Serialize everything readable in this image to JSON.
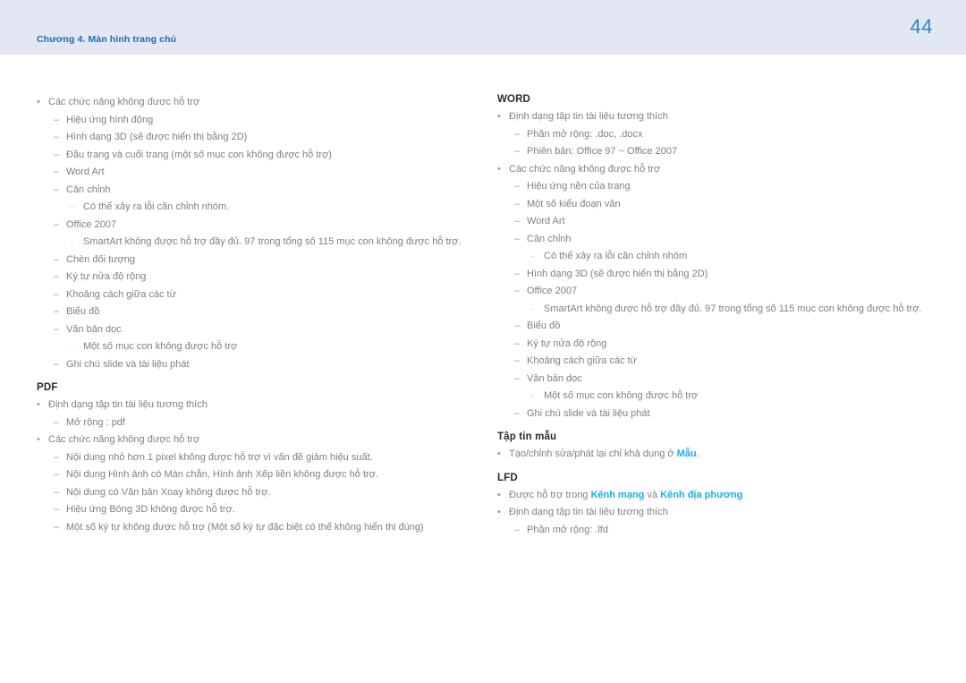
{
  "header": {
    "chapter": "Chương 4. Màn hình trang chủ",
    "page_number": "44",
    "band_color": "#e3e7f4",
    "chapter_color": "#1a6cb2",
    "page_number_color": "#2589c9"
  },
  "theme": {
    "body_text_color": "#808080",
    "heading_color": "#2b2b2b",
    "link_color": "#15b0ea",
    "marker_color": "#9a9a9a"
  },
  "markers": {
    "level1": "•",
    "level2": "–",
    "level3": "·"
  },
  "left_column": {
    "blocks": [
      {
        "heading": null,
        "items": [
          {
            "level": 1,
            "text": "Các chức năng không được hỗ trợ"
          },
          {
            "level": 2,
            "text": "Hiệu ứng hình động"
          },
          {
            "level": 2,
            "text": "Hình dạng 3D (sẽ được hiển thị bằng 2D)"
          },
          {
            "level": 2,
            "text": "Đầu trang và cuối trang (một số mục con không được hỗ trợ)"
          },
          {
            "level": 2,
            "text": "Word Art"
          },
          {
            "level": 2,
            "text": "Căn chỉnh"
          },
          {
            "level": 3,
            "text": "Có thể xảy ra lỗi căn chỉnh nhóm."
          },
          {
            "level": 2,
            "text": "Office 2007"
          },
          {
            "level": 3,
            "text": "SmartArt không được hỗ trợ đầy đủ. 97 trong tổng số 115 mục con không được hỗ trợ."
          },
          {
            "level": 2,
            "text": "Chèn đối tượng"
          },
          {
            "level": 2,
            "text": "Ký tự nửa độ rộng"
          },
          {
            "level": 2,
            "text": "Khoảng cách giữa các từ"
          },
          {
            "level": 2,
            "text": "Biểu đồ"
          },
          {
            "level": 2,
            "text": "Văn bản dọc"
          },
          {
            "level": 3,
            "text": "Một số mục con không được hỗ trợ"
          },
          {
            "level": 2,
            "text": "Ghi chú slide và tài liệu phát"
          }
        ]
      },
      {
        "heading": "PDF",
        "items": [
          {
            "level": 1,
            "text": "Định dạng tập tin tài liệu tương thích"
          },
          {
            "level": 2,
            "text": "Mở rộng : pdf"
          },
          {
            "level": 1,
            "text": "Các chức năng không được hỗ trợ"
          },
          {
            "level": 2,
            "text": "Nội dung nhỏ hơn 1 pixel không được hỗ trợ vì vấn đề giảm hiệu suất."
          },
          {
            "level": 2,
            "text": "Nội dung Hình ảnh có Màn chắn, Hình ảnh Xếp liền không được hỗ trợ."
          },
          {
            "level": 2,
            "text": "Nội dung có Văn bản Xoay không được hỗ trợ."
          },
          {
            "level": 2,
            "text": "Hiệu ứng Bóng 3D không được hỗ trợ."
          },
          {
            "level": 2,
            "text": "Một số ký tự không được hỗ trợ (Một số ký tự đặc biệt có thể không hiển thị đúng)"
          }
        ]
      }
    ]
  },
  "right_column": {
    "blocks": [
      {
        "heading": "WORD",
        "items": [
          {
            "level": 1,
            "text": "Định dạng tập tin tài liệu tương thích"
          },
          {
            "level": 2,
            "text": "Phần mở rộng: .doc, .docx"
          },
          {
            "level": 2,
            "text": "Phiên bản: Office 97 ~ Office 2007"
          },
          {
            "level": 1,
            "text": "Các chức năng không được hỗ trợ"
          },
          {
            "level": 2,
            "text": "Hiệu ứng nền của trang"
          },
          {
            "level": 2,
            "text": "Một số kiểu đoạn văn"
          },
          {
            "level": 2,
            "text": "Word Art"
          },
          {
            "level": 2,
            "text": "Căn chỉnh"
          },
          {
            "level": 3,
            "text": "Có thể xảy ra lỗi căn chỉnh nhóm"
          },
          {
            "level": 2,
            "text": "Hình dạng 3D (sẽ được hiển thị bằng 2D)"
          },
          {
            "level": 2,
            "text": "Office 2007"
          },
          {
            "level": 3,
            "text": "SmartArt không được hỗ trợ đầy đủ. 97 trong tổng số 115 mục con không được hỗ trợ."
          },
          {
            "level": 2,
            "text": "Biểu đồ"
          },
          {
            "level": 2,
            "text": "Ký tự nửa độ rộng"
          },
          {
            "level": 2,
            "text": "Khoảng cách giữa các từ"
          },
          {
            "level": 2,
            "text": "Văn bản dọc"
          },
          {
            "level": 3,
            "text": "Một số mục con không được hỗ trợ"
          },
          {
            "level": 2,
            "text": "Ghi chú slide và tài liệu phát"
          }
        ]
      },
      {
        "heading": "Tập tin mẫu",
        "items": [
          {
            "level": 1,
            "segments": [
              {
                "text": "Tạo/chỉnh sửa/phát lại chỉ khả dụng ở ",
                "link": false
              },
              {
                "text": "Mẫu",
                "link": true
              },
              {
                "text": ".",
                "link": false
              }
            ]
          }
        ]
      },
      {
        "heading": "LFD",
        "items": [
          {
            "level": 1,
            "segments": [
              {
                "text": "Được hỗ trợ trong ",
                "link": false
              },
              {
                "text": "Kênh mạng",
                "link": true
              },
              {
                "text": " và ",
                "link": false
              },
              {
                "text": "Kênh địa phương",
                "link": true
              }
            ]
          },
          {
            "level": 1,
            "text": "Định dạng tập tin tài liệu tương thích"
          },
          {
            "level": 2,
            "text": "Phần mở rộng: .lfd"
          }
        ]
      }
    ]
  }
}
